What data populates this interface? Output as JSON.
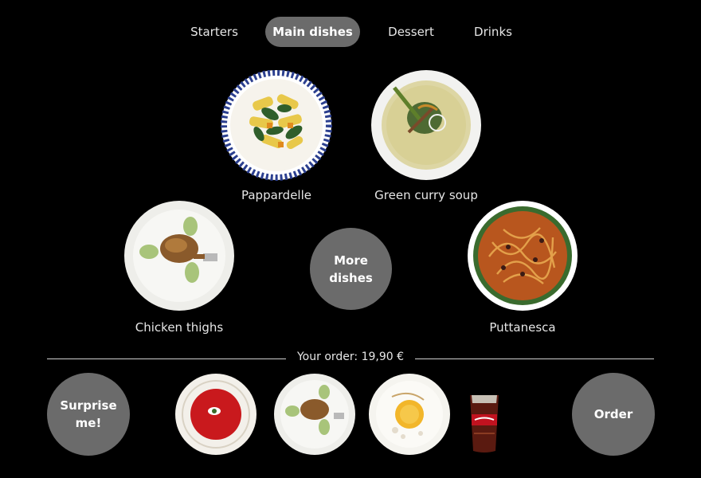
{
  "tabs": [
    {
      "label": "Starters",
      "active": false
    },
    {
      "label": "Main dishes",
      "active": true
    },
    {
      "label": "Dessert",
      "active": false
    },
    {
      "label": "Drinks",
      "active": false
    }
  ],
  "dishes": [
    {
      "name": "Pappardelle",
      "icon": "pappardelle-plate-icon"
    },
    {
      "name": "Green curry soup",
      "icon": "curry-soup-bowl-icon"
    },
    {
      "name": "Chicken thighs",
      "icon": "chicken-plate-icon"
    },
    {
      "name": "Puttanesca",
      "icon": "puttanesca-plate-icon"
    }
  ],
  "more_dishes_label": "More\ndishes",
  "order": {
    "total_text": "Your order: 19,90 €",
    "items": [
      {
        "icon": "tomato-soup-bowl-icon"
      },
      {
        "icon": "chicken-plate-icon"
      },
      {
        "icon": "dessert-plate-icon"
      },
      {
        "icon": "cola-glass-icon"
      }
    ],
    "surprise_label": "Surprise\nme!",
    "order_label": "Order"
  },
  "colors": {
    "background": "#000000",
    "button": "#6b6b6b",
    "text": "#e6e6e6"
  }
}
